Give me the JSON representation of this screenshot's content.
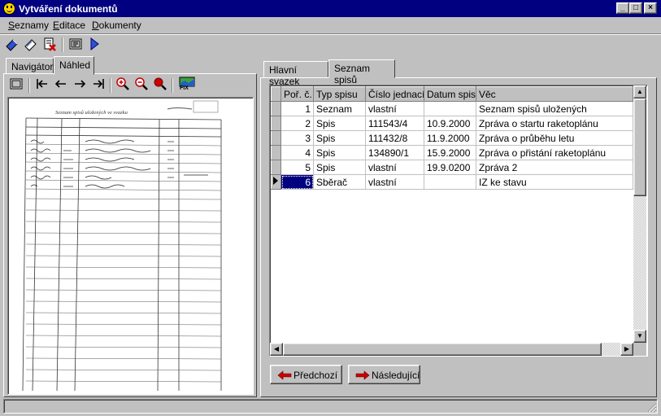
{
  "window": {
    "title": "Vytváření dokumentů",
    "buttons": [
      "_",
      "□",
      "×"
    ]
  },
  "menu": [
    {
      "label": "Seznamy",
      "accel": "S"
    },
    {
      "label": "Editace",
      "accel": "E"
    },
    {
      "label": "Dokumenty",
      "accel": "D"
    }
  ],
  "left_tabs": [
    "Navigátor",
    "Náhled"
  ],
  "preview": {
    "nav_buttons": [
      "first",
      "prev",
      "next",
      "last"
    ],
    "zoom_buttons": [
      "zoom-in",
      "zoom-out",
      "zoom-stop"
    ],
    "fix_label": "FIX",
    "doc_heading": "Seznam spisů uložených ve svazku"
  },
  "right_tabs": [
    "Hlavní svazek",
    "Seznam spisů"
  ],
  "table": {
    "columns": [
      "Poř. č.",
      "Typ spisu",
      "Číslo jednací",
      "Datum spisu",
      "Věc"
    ],
    "rows": [
      [
        "1",
        "Seznam",
        "vlastní",
        "",
        "Seznam spisů uložených"
      ],
      [
        "2",
        "Spis",
        "111543/4",
        "10.9.2000",
        "Zpráva o startu raketoplánu"
      ],
      [
        "3",
        "Spis",
        "111432/8",
        "11.9.2000",
        "Zpráva o průběhu letu"
      ],
      [
        "4",
        "Spis",
        "134890/1",
        "15.9.2000",
        "Zpráva o přistání raketoplánu"
      ],
      [
        "5",
        "Spis",
        "vlastní",
        "19.9.0200",
        "Zpráva 2"
      ],
      [
        "6",
        "Sběrač",
        "vlastní",
        "",
        "IZ ke stavu"
      ]
    ],
    "selected_row": 6
  },
  "buttons": {
    "prev": "Předchozí",
    "next": "Následující"
  },
  "colors": {
    "title_bar": "#000080",
    "face": "#c0c0c0",
    "selection": "#000080",
    "arrow_red": "#cc0000"
  }
}
